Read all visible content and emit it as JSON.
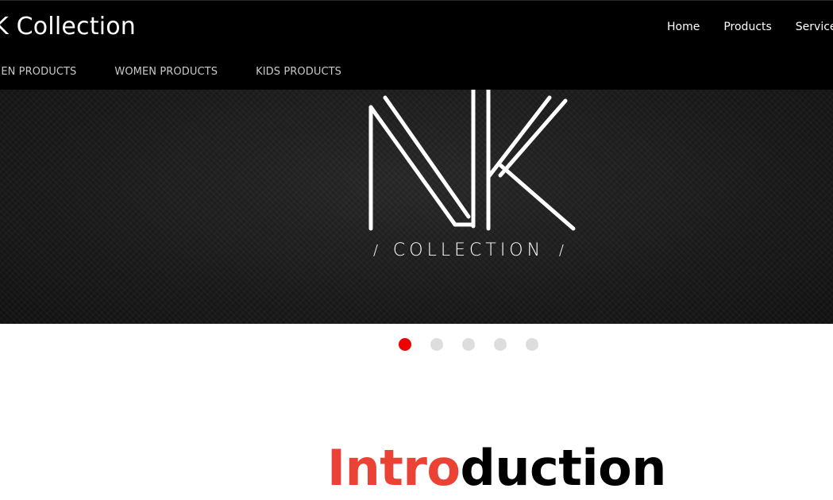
{
  "header": {
    "brand": "K Collection",
    "main_nav": [
      "Home",
      "Products",
      "Services"
    ],
    "category_nav": [
      "MEN PRODUCTS",
      "WOMEN PRODUCTS",
      "KIDS PRODUCTS"
    ]
  },
  "hero": {
    "logo_word": "COLLECTION",
    "logo_slash_left": "/",
    "logo_slash_right": "/"
  },
  "carousel": {
    "slide_count": 5,
    "active_index": 0,
    "active_color": "#ee0000",
    "inactive_color": "#dddddd"
  },
  "intro": {
    "accent": "Intro",
    "rest": "duction",
    "accent_color": "#ea4335"
  }
}
